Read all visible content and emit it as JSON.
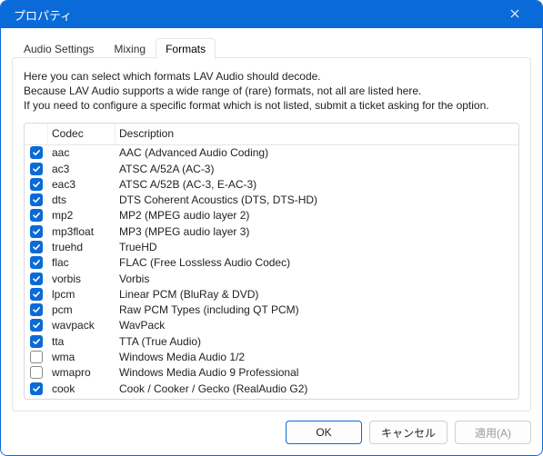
{
  "window": {
    "title": "プロパティ"
  },
  "tabs": [
    {
      "label": "Audio Settings",
      "active": false
    },
    {
      "label": "Mixing",
      "active": false
    },
    {
      "label": "Formats",
      "active": true
    }
  ],
  "help": {
    "line1": "Here you can select which formats LAV Audio should decode.",
    "line2": "Because LAV Audio supports a wide range of (rare) formats, not all are listed here.",
    "line3": "If you need to configure a specific format which is not listed, submit a ticket asking for the option."
  },
  "columns": {
    "c1": "",
    "c2": "Codec",
    "c3": "Description"
  },
  "rows": [
    {
      "checked": true,
      "codec": "aac",
      "desc": "AAC (Advanced Audio Coding)"
    },
    {
      "checked": true,
      "codec": "ac3",
      "desc": "ATSC A/52A (AC-3)"
    },
    {
      "checked": true,
      "codec": "eac3",
      "desc": "ATSC A/52B (AC-3, E-AC-3)"
    },
    {
      "checked": true,
      "codec": "dts",
      "desc": "DTS Coherent Acoustics (DTS, DTS-HD)"
    },
    {
      "checked": true,
      "codec": "mp2",
      "desc": "MP2 (MPEG audio layer 2)"
    },
    {
      "checked": true,
      "codec": "mp3float",
      "desc": "MP3 (MPEG audio layer 3)"
    },
    {
      "checked": true,
      "codec": "truehd",
      "desc": "TrueHD"
    },
    {
      "checked": true,
      "codec": "flac",
      "desc": "FLAC (Free Lossless Audio Codec)"
    },
    {
      "checked": true,
      "codec": "vorbis",
      "desc": "Vorbis"
    },
    {
      "checked": true,
      "codec": "lpcm",
      "desc": "Linear PCM (BluRay & DVD)"
    },
    {
      "checked": true,
      "codec": "pcm",
      "desc": "Raw PCM Types (including QT PCM)"
    },
    {
      "checked": true,
      "codec": "wavpack",
      "desc": "WavPack"
    },
    {
      "checked": true,
      "codec": "tta",
      "desc": "TTA (True Audio)"
    },
    {
      "checked": false,
      "codec": "wma",
      "desc": "Windows Media Audio 1/2"
    },
    {
      "checked": false,
      "codec": "wmapro",
      "desc": "Windows Media Audio 9 Professional"
    },
    {
      "checked": true,
      "codec": "cook",
      "desc": "Cook / Cooker / Gecko (RealAudio G2)"
    }
  ],
  "buttons": {
    "ok": "OK",
    "cancel": "キャンセル",
    "apply": "適用(A)"
  }
}
